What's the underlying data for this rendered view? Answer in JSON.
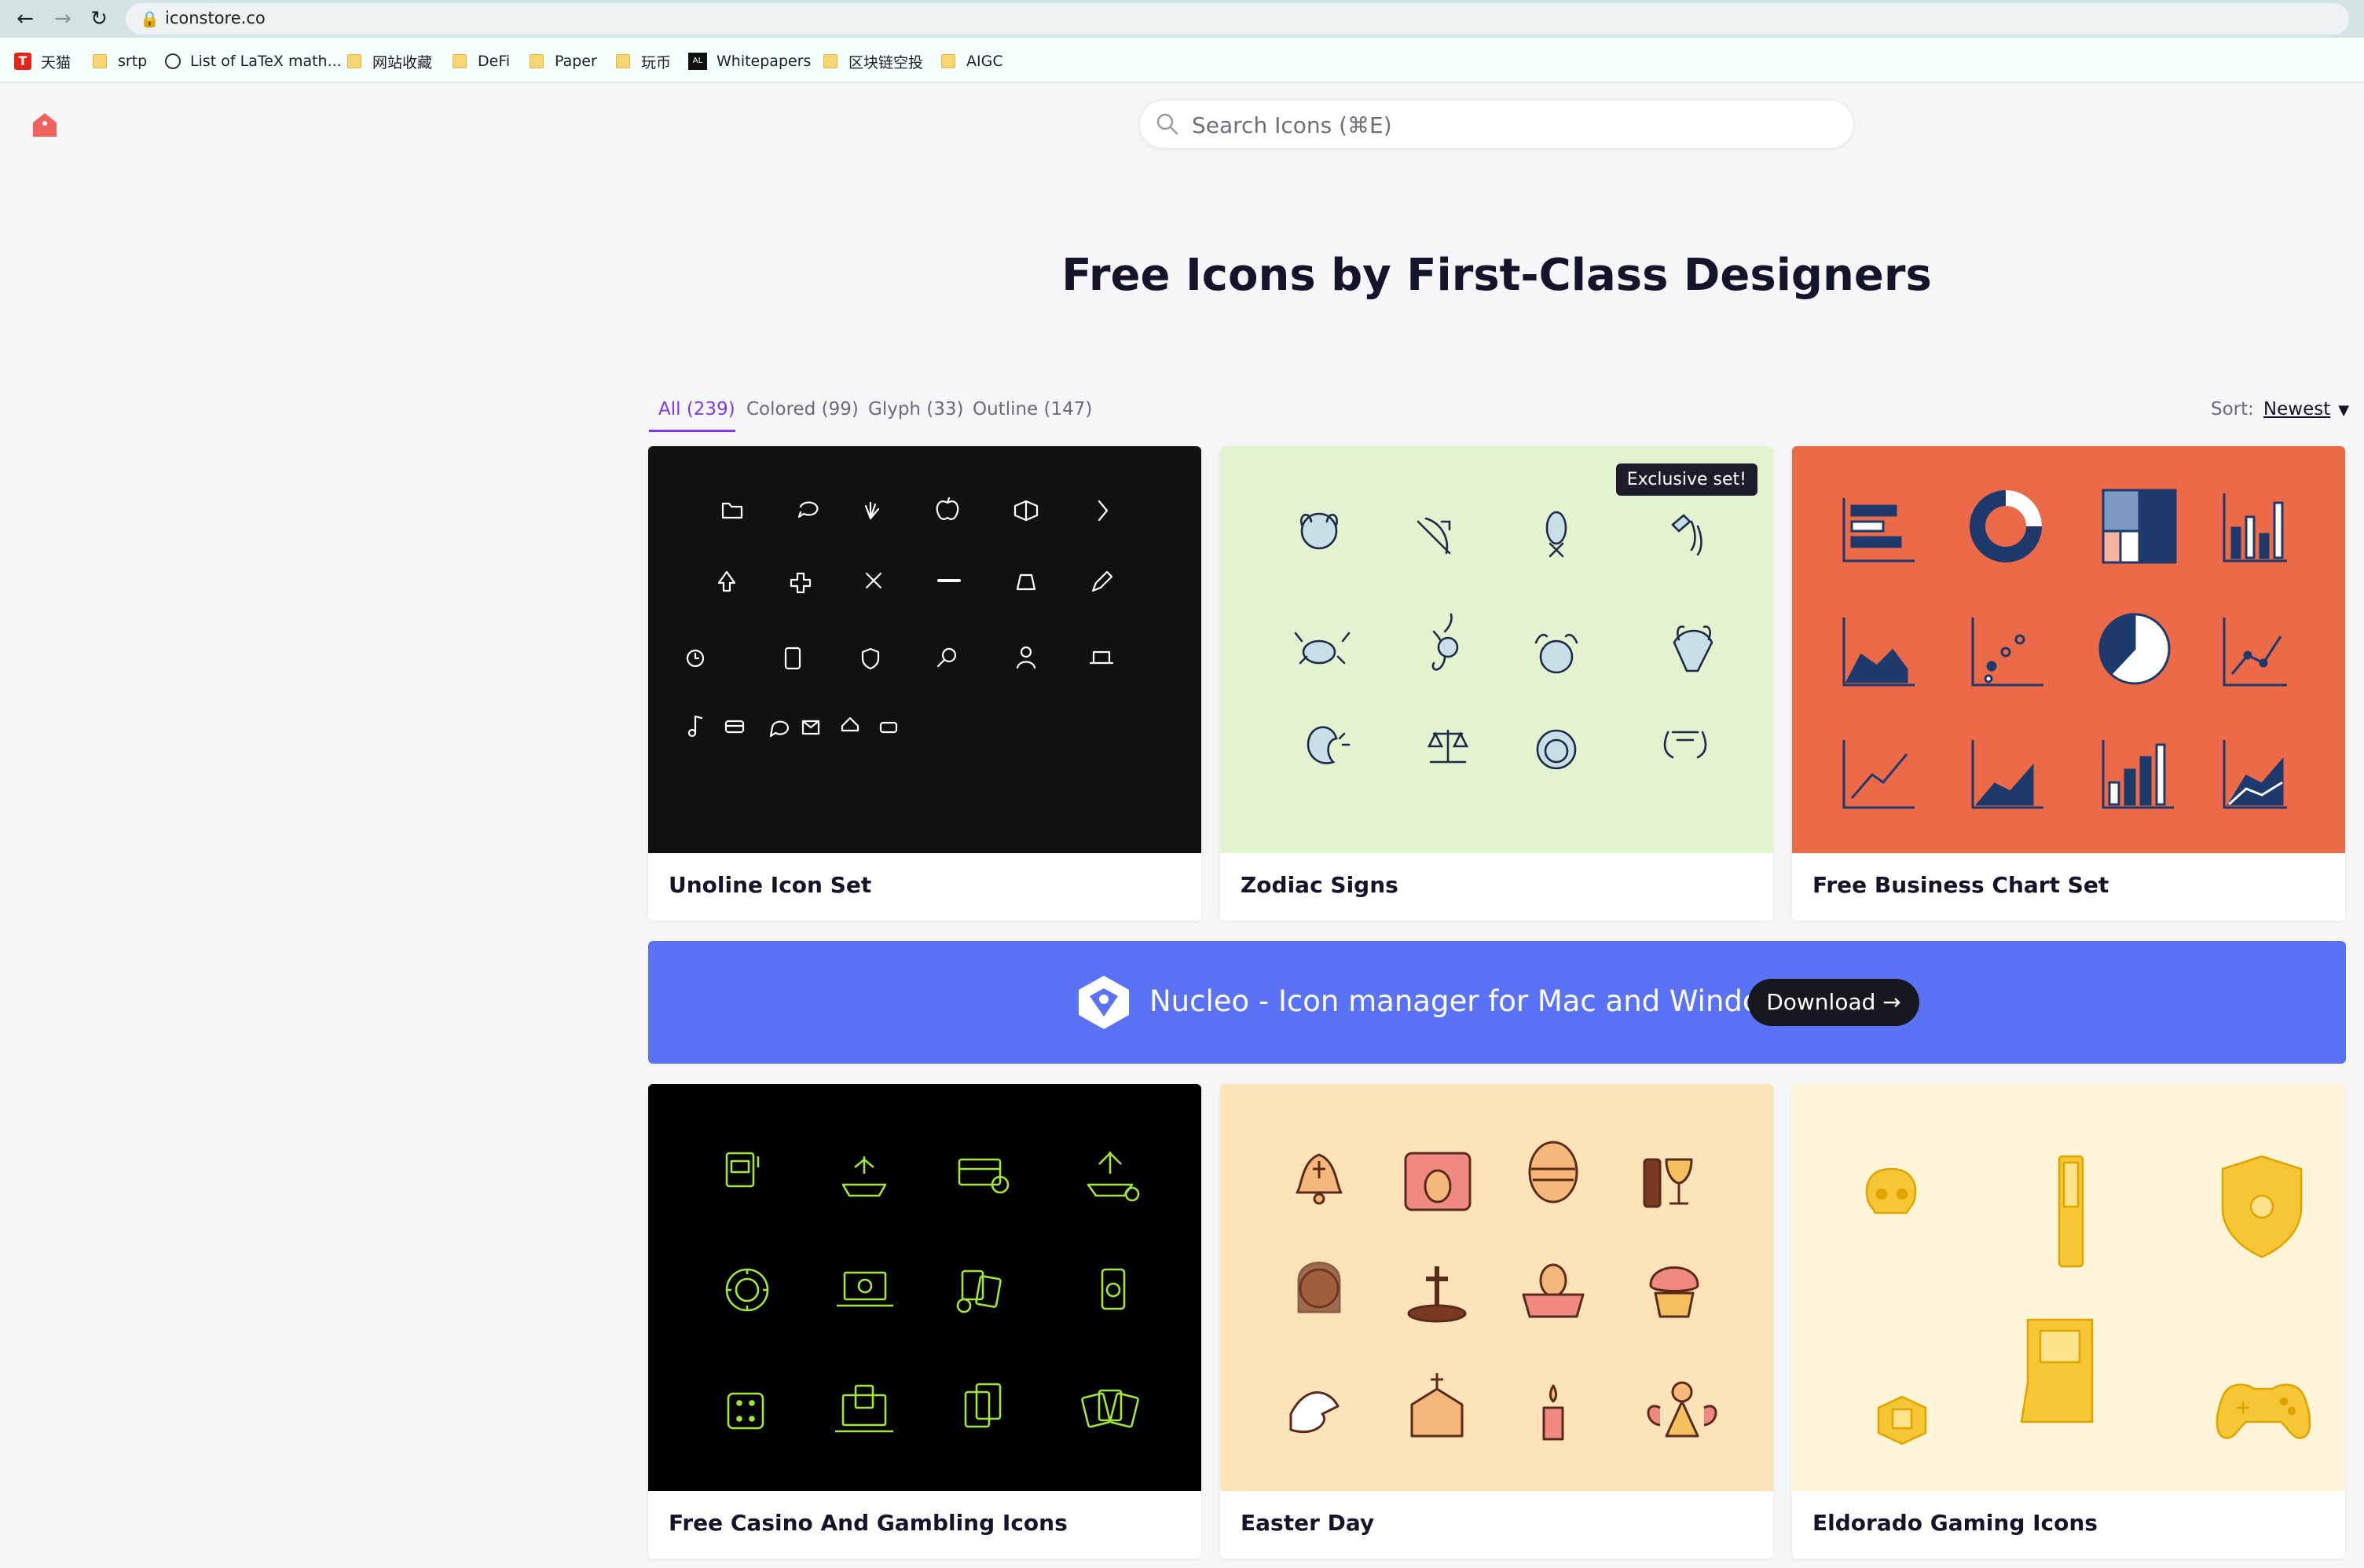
{
  "browser": {
    "url": "iconstore.co",
    "bookmarks": [
      "天猫",
      "srtp",
      "List of LaTeX math...",
      "网站收藏",
      "DeFi",
      "Paper",
      "玩币",
      "Whitepapers",
      "区块链空投",
      "AIGC"
    ]
  },
  "search": {
    "placeholder": "Search Icons (⌘E)"
  },
  "hero": {
    "title": "Free Icons by First-Class Designers"
  },
  "tabs": [
    {
      "label": "All (239)",
      "active": true
    },
    {
      "label": "Colored (99)",
      "active": false
    },
    {
      "label": "Glyph (33)",
      "active": false
    },
    {
      "label": "Outline (147)",
      "active": false
    }
  ],
  "sort": {
    "label": "Sort:",
    "value": "Newest"
  },
  "cards": [
    {
      "title": "Unoline Icon Set",
      "bg": "#111111",
      "icon_color": "#ffffff"
    },
    {
      "title": "Zodiac Signs",
      "bg": "#e3f3cf",
      "icon_color": "#1d2a4a",
      "badge": "Exclusive set!"
    },
    {
      "title": "Free Business Chart Set",
      "bg": "#ec6a47",
      "icon_color": "#1e3a6d"
    },
    {
      "title": "Free Casino And Gambling Icons",
      "bg": "#000000",
      "icon_color": "#a3e635"
    },
    {
      "title": "Easter Day",
      "bg": "#fde3b8",
      "icon_color": "#5a2b1a"
    },
    {
      "title": "Eldorado Gaming Icons",
      "bg": "#fef5d9",
      "icon_color": "#f6c636"
    }
  ],
  "banner": {
    "text": "Nucleo - Icon manager for Mac and Windows",
    "button": "Download →",
    "bg": "#5a72f5"
  },
  "colors": {
    "accent": "#7c3aed",
    "logo": "#f0625d"
  }
}
